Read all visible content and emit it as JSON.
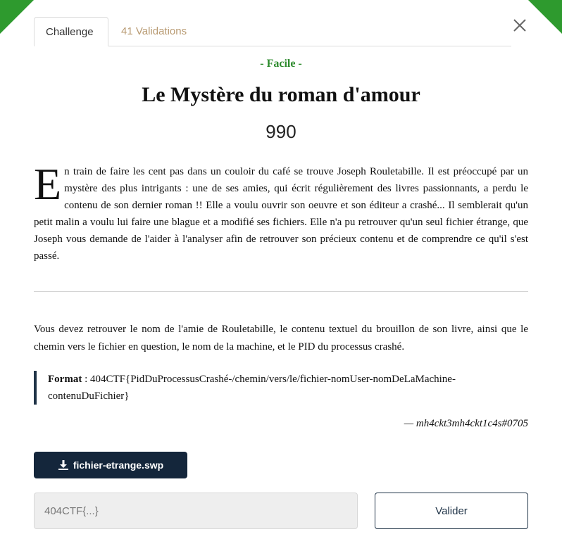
{
  "tabs": [
    {
      "label": "Challenge",
      "active": true
    },
    {
      "label": "41 Validations",
      "active": false
    }
  ],
  "challenge": {
    "difficulty": "- Facile -",
    "title": "Le Mystère du roman d'amour",
    "points": "990",
    "description_dropcap": "E",
    "description_rest": "n train de faire les cent pas dans un couloir du café se trouve Joseph Rouletabille. Il est préoccupé par un mystère des plus intrigants : une de ses amies, qui écrit régulièrement des livres passionnants, a perdu le contenu de son dernier roman !! Elle a voulu ouvrir son oeuvre et son éditeur a crashé... Il semblerait qu'un petit malin a voulu lui faire une blague et a modifié ses fichiers. Elle n'a pu retrouver qu'un seul fichier étrange, que Joseph vous demande de l'aider à l'analyser afin de retrouver son précieux contenu et de comprendre ce qu'il s'est passé.",
    "task": "Vous devez retrouver le nom de l'amie de Rouletabille, le contenu textuel du brouillon de son livre, ainsi que le chemin vers le fichier en question, le nom de la machine, et le PID du processus crashé.",
    "format_label": "Format",
    "format_value": " : 404CTF{PidDuProcessusCrashé-/chemin/vers/le/fichier-nomUser-nomDeLaMachine-contenuDuFichier}",
    "author": "— mh4ckt3mh4ckt1c4s#0705"
  },
  "download": {
    "label": "fichier-etrange.swp",
    "icon": "download-icon"
  },
  "flag_input": {
    "placeholder": "404CTF{...}",
    "value": ""
  },
  "submit": {
    "label": "Valider"
  },
  "colors": {
    "accent_green": "#2e9a2e",
    "dark_navy": "#14263b",
    "tab_inactive": "#b89a72"
  }
}
